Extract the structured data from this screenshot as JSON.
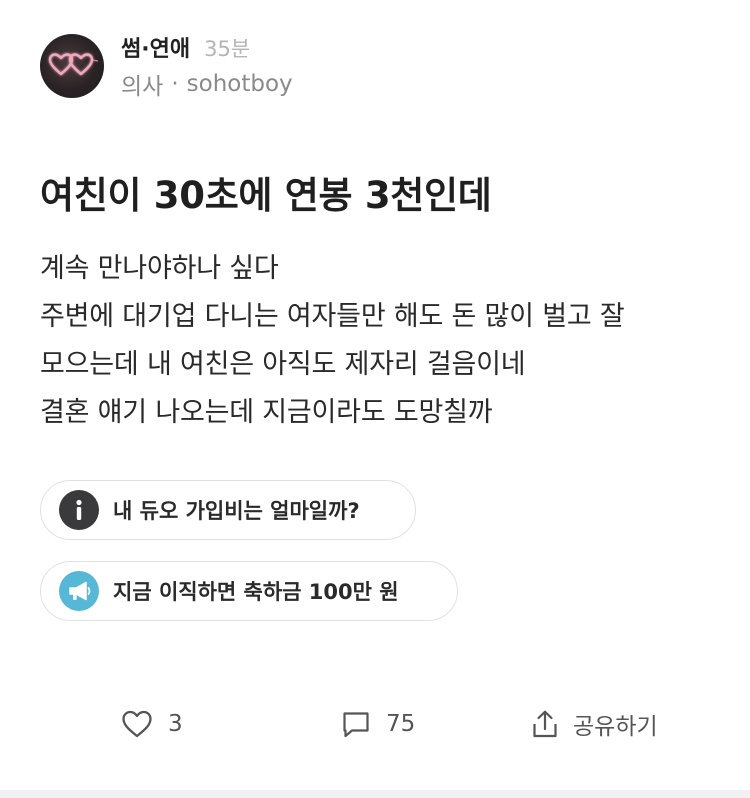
{
  "post": {
    "channel": "썸·연애",
    "time": "35분",
    "author_role": "의사",
    "separator": "·",
    "author_name": "sohotboy",
    "avatar_icon": "hearts-neon-icon",
    "title": "여친이 30초에 연봉 3천인데",
    "body_lines": [
      "계속 만나야하나 싶다",
      "주변에 대기업 다니는 여자들만 해도 돈 많이 벌고 잘",
      "모으는데 내 여친은 아직도 제자리 걸음이네",
      "결혼 얘기 나오는데 지금이라도 도망칠까"
    ]
  },
  "chips": [
    {
      "icon": "info-icon",
      "label": "내 듀오 가입비는 얼마일까?",
      "icon_color": "#3a3a3c"
    },
    {
      "icon": "megaphone-icon",
      "label": "지금 이직하면 축하금 100만 원",
      "icon_color": "#57b7d6"
    }
  ],
  "actions": {
    "like_count": "3",
    "comment_count": "75",
    "share_label": "공유하기"
  }
}
